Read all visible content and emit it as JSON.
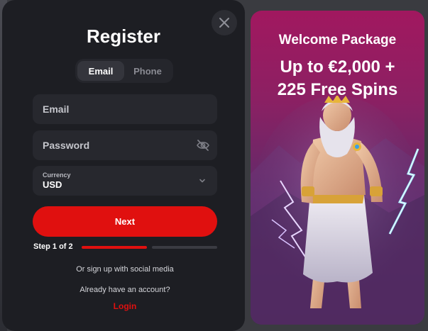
{
  "form": {
    "title": "Register",
    "tabs": [
      {
        "label": "Email",
        "active": true
      },
      {
        "label": "Phone",
        "active": false
      }
    ],
    "email_placeholder": "Email",
    "password_placeholder": "Password",
    "currency_label": "Currency",
    "currency_value": "USD",
    "next_label": "Next",
    "step_label": "Step 1 of 2",
    "step_progress": 0.5,
    "social_text": "Or sign up with social media",
    "account_text": "Already have an account?",
    "login_label": "Login",
    "accent_color": "#e0100f"
  },
  "icons": {
    "close": "close-icon",
    "password_toggle": "eye-slash-icon",
    "currency_dropdown": "chevron-down-icon"
  },
  "promo": {
    "title": "Welcome Package",
    "amount_line1": "Up to €2,000 +",
    "amount_line2": "225 Free Spins"
  }
}
